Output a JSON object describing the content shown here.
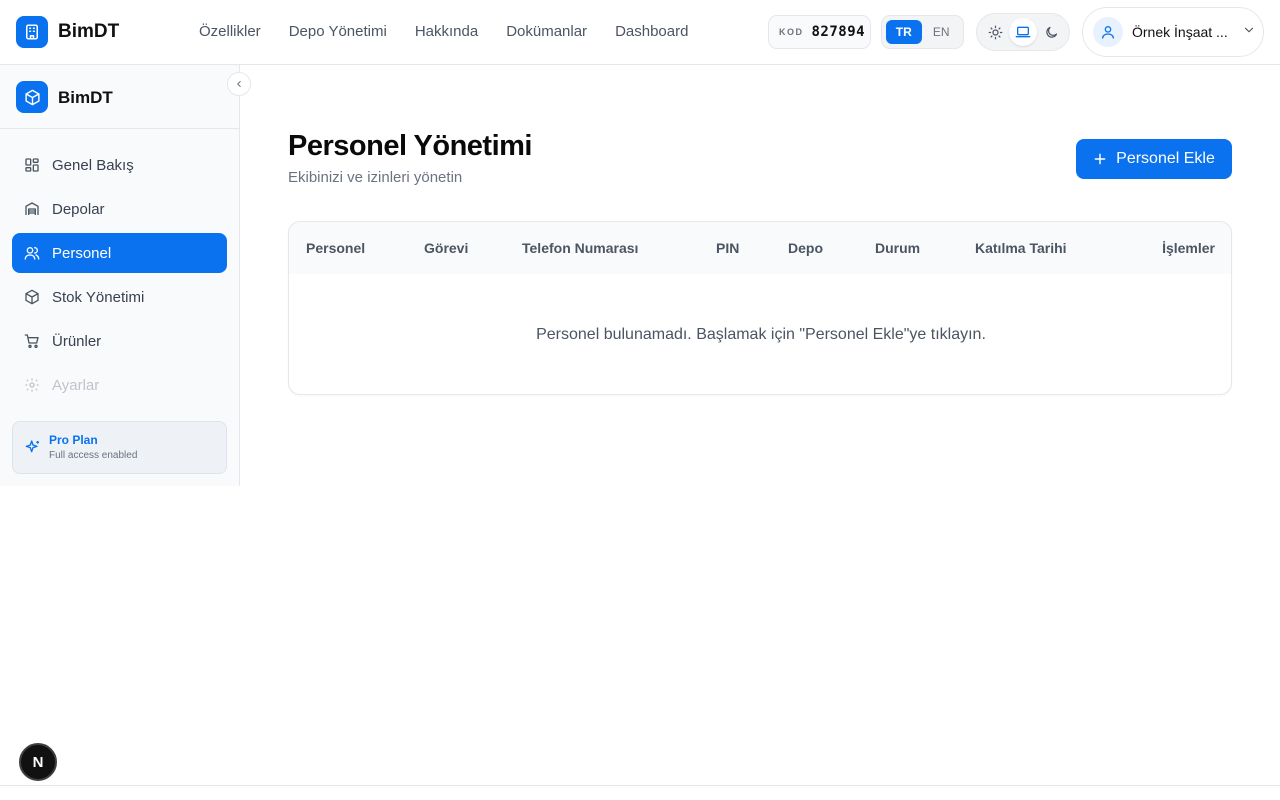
{
  "header": {
    "brand": "BimDT",
    "nav": [
      "Özellikler",
      "Depo Yönetimi",
      "Hakkında",
      "Dokümanlar",
      "Dashboard"
    ],
    "code_label": "KOD",
    "code_value": "827894",
    "languages": [
      "TR",
      "EN"
    ],
    "active_language": "TR",
    "theme_options": [
      "sun-icon",
      "laptop-icon",
      "moon-icon"
    ],
    "active_theme": "laptop-icon",
    "user_name": "Örnek İnşaat ..."
  },
  "sidebar": {
    "brand": "BimDT",
    "items": [
      {
        "label": "Genel Bakış",
        "icon": "grid-icon"
      },
      {
        "label": "Depolar",
        "icon": "warehouse-icon"
      },
      {
        "label": "Personel",
        "icon": "users-icon"
      },
      {
        "label": "Stok Yönetimi",
        "icon": "box-icon"
      },
      {
        "label": "Ürünler",
        "icon": "cart-icon"
      },
      {
        "label": "Ayarlar",
        "icon": "gear-icon"
      }
    ],
    "active_item": "Personel",
    "disabled_item": "Ayarlar",
    "plan_title": "Pro Plan",
    "plan_subtitle": "Full access enabled"
  },
  "main": {
    "title": "Personel Yönetimi",
    "subtitle": "Ekibinizi ve izinleri yönetin",
    "add_button": "Personel Ekle",
    "table_headers": [
      "Personel",
      "Görevi",
      "Telefon Numarası",
      "PIN",
      "Depo",
      "Durum",
      "Katılma Tarihi",
      "İşlemler"
    ],
    "empty_message": "Personel bulunamadı. Başlamak için \"Personel Ekle\"ye tıklayın."
  },
  "overlay": {
    "badge": "N"
  },
  "colors": {
    "accent": "#0a72ef"
  }
}
